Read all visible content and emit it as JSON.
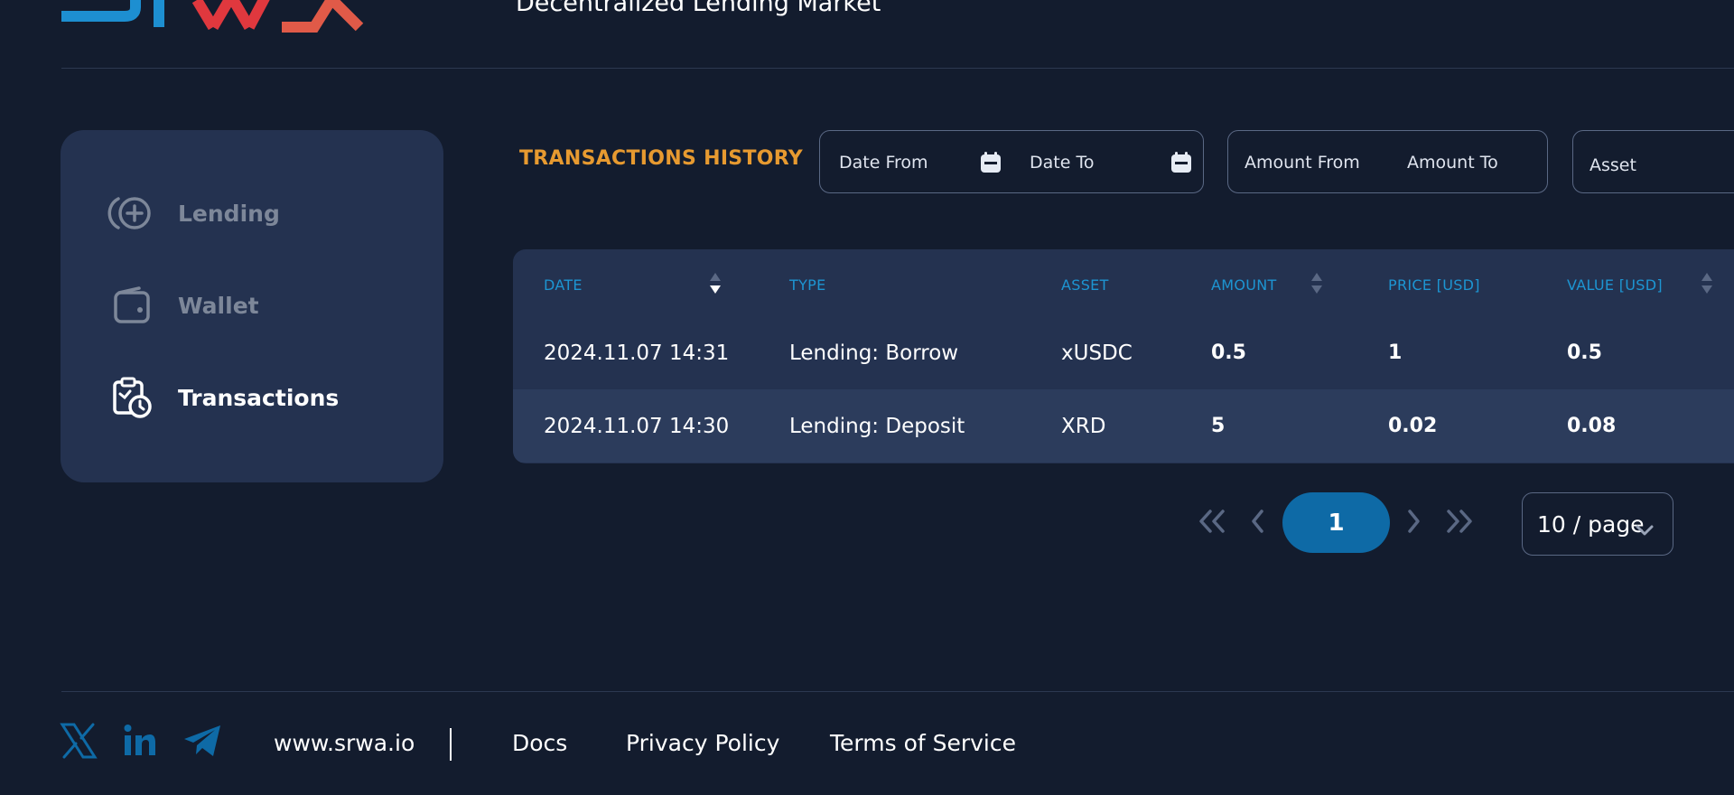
{
  "header": {
    "tagline": "Decentralized Lending Market"
  },
  "logo": {
    "text": "SRWA"
  },
  "sidebar": {
    "items": [
      {
        "label": "Lending",
        "icon": "lending-icon",
        "active": false
      },
      {
        "label": "Wallet",
        "icon": "wallet-icon",
        "active": false
      },
      {
        "label": "Transactions",
        "icon": "transactions-icon",
        "active": true
      }
    ]
  },
  "transactions": {
    "title": "TRANSACTIONS HISTORY",
    "filters": {
      "date_from": "Date From",
      "date_to": "Date To",
      "amount_from": "Amount From",
      "amount_to": "Amount To",
      "asset": "Asset"
    },
    "columns": [
      "DATE",
      "TYPE",
      "ASSET",
      "AMOUNT",
      "PRICE [USD]",
      "VALUE [USD]"
    ],
    "rows": [
      {
        "date": "2024.11.07 14:31",
        "type": "Lending: Borrow",
        "asset": "xUSDC",
        "amount": "0.5",
        "price": "1",
        "value": "0.5"
      },
      {
        "date": "2024.11.07 14:30",
        "type": "Lending: Deposit",
        "asset": "XRD",
        "amount": "5",
        "price": "0.02",
        "value": "0.08"
      }
    ]
  },
  "pagination": {
    "current_page": "1",
    "page_size": "10 / page"
  },
  "footer": {
    "website": "www.srwa.io",
    "links": [
      "Docs",
      "Privacy Policy",
      "Terms of Service"
    ],
    "social": [
      "x-icon",
      "linkedin-icon",
      "telegram-icon"
    ]
  },
  "colors": {
    "background": "#131c2e",
    "panel": "#243250",
    "row_alt": "#2c3c5c",
    "accent_orange": "#e79a30",
    "accent_blue": "#1d95d2",
    "button_blue": "#0e6aa6",
    "muted": "#7d8799"
  }
}
